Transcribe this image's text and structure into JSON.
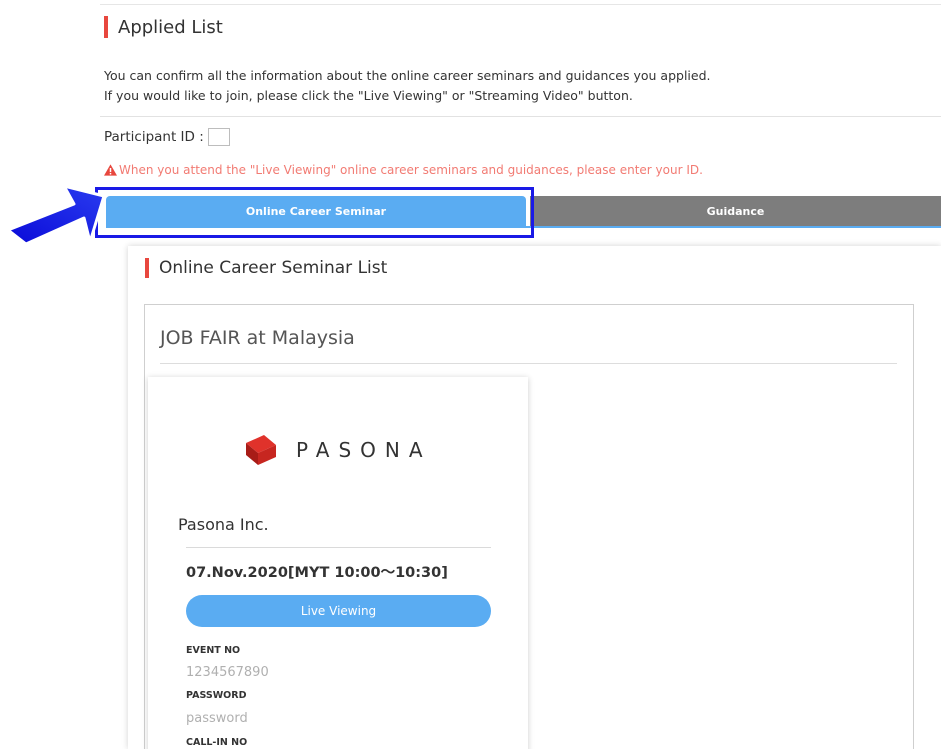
{
  "header": {
    "title": "Applied List"
  },
  "intro": {
    "line1": "You can confirm all the information about the online career seminars and guidances you applied.",
    "line2": "If you would like to join, please click the \"Live Viewing\" or \"Streaming Video\" button."
  },
  "participant": {
    "label": "Participant ID :",
    "value": ""
  },
  "warning": {
    "text": "When you attend the \"Live Viewing\" online career seminars and guidances, please enter your ID."
  },
  "tabs": [
    {
      "label": "Online Career Seminar",
      "active": true
    },
    {
      "label": "Guidance",
      "active": false
    }
  ],
  "seminar_list": {
    "title": "Online Career Seminar List",
    "event": {
      "title": "JOB FAIR at Malaysia",
      "company": {
        "logo_text": "PASONA",
        "name": "Pasona Inc.",
        "datetime": "07.Nov.2020[MYT 10:00～10:30]",
        "button_label": "Live Viewing",
        "event_no_label": "EVENT NO",
        "event_no": "1234567890",
        "password_label": "PASSWORD",
        "password": "password",
        "call_in_label": "CALL-IN NO"
      }
    }
  },
  "colors": {
    "accent": "#5aacf2",
    "brand_red": "#e8473e",
    "highlight": "#1a1ae6",
    "warning": "#f27b73",
    "tab_inactive": "#7d7d7d"
  },
  "icons": {
    "warning": "warning-icon",
    "pointer": "arrow-pointer-icon",
    "logo": "pasona-logo-icon"
  }
}
